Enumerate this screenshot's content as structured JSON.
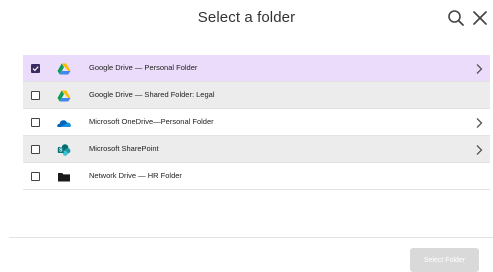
{
  "dialog": {
    "title": "Select a folder",
    "search_icon": "search-icon",
    "close_icon": "close-icon"
  },
  "folders": [
    {
      "label": "Google Drive — Personal Folder",
      "icon": "google-drive-icon",
      "checked": true,
      "has_children": true
    },
    {
      "label": "Google Drive — Shared Folder: Legal",
      "icon": "google-drive-icon",
      "checked": false,
      "has_children": false
    },
    {
      "label": "Microsoft OneDrive—Personal Folder",
      "icon": "onedrive-icon",
      "checked": false,
      "has_children": true
    },
    {
      "label": "Microsoft SharePoint",
      "icon": "sharepoint-icon",
      "checked": false,
      "has_children": true
    },
    {
      "label": "Network Drive — HR Folder",
      "icon": "folder-icon",
      "checked": false,
      "has_children": false
    }
  ],
  "footer": {
    "select_label": "Select Folder",
    "select_enabled": false
  },
  "colors": {
    "selected_row": "#ebdcfb",
    "shaded_row": "#ececec",
    "checkbox_checked": "#3b2a62",
    "button_disabled": "#d9d9d9"
  }
}
